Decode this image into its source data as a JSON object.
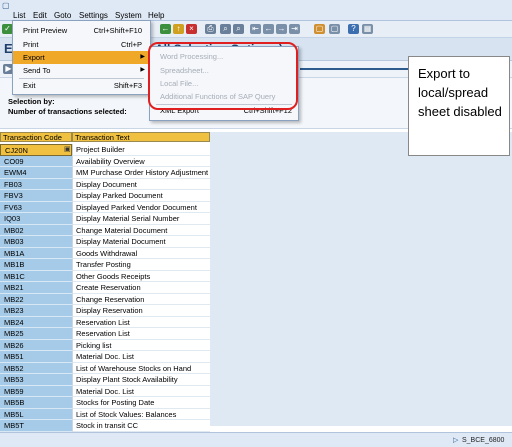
{
  "menubar": {
    "items": [
      "List",
      "Edit",
      "Goto",
      "Settings",
      "System",
      "Help"
    ]
  },
  "window": {
    "title": "All Selection Options )",
    "title_prefix": "E"
  },
  "info": {
    "selected_by": "Selection by:",
    "num_transactions": "Number of transactions selected:"
  },
  "list_menu": {
    "items": [
      {
        "label": "Print Preview",
        "shortcut": "Ctrl+Shift+F10"
      },
      {
        "label": "Print",
        "shortcut": "Ctrl+P"
      },
      {
        "label": "Export",
        "shortcut": ""
      },
      {
        "label": "Send To",
        "shortcut": ""
      },
      {
        "label": "Exit",
        "shortcut": "Shift+F3"
      }
    ]
  },
  "export_menu": {
    "items": [
      {
        "label": "Word Processing...",
        "shortcut": ""
      },
      {
        "label": "Spreadsheet...",
        "shortcut": ""
      },
      {
        "label": "Local File...",
        "shortcut": ""
      },
      {
        "label": "Additional Functions of SAP Query",
        "shortcut": ""
      },
      {
        "label": "XML Export",
        "shortcut": "Ctrl+Shift+F12"
      }
    ]
  },
  "annotation": {
    "text": "Export to local/spread sheet disabled"
  },
  "grid": {
    "headers": [
      "Transaction Code",
      "Transaction Text"
    ],
    "rows": [
      [
        "CJ20N",
        "Project Builder"
      ],
      [
        "CO09",
        "Availability Overview"
      ],
      [
        "EWM4",
        "MM Purchase Order History Adjustment"
      ],
      [
        "FB03",
        "Display Document"
      ],
      [
        "FBV3",
        "Display Parked Document"
      ],
      [
        "FV63",
        "Displayed Parked Vendor Document"
      ],
      [
        "IQ03",
        "Display Material Serial Number"
      ],
      [
        "MB02",
        "Change Material Document"
      ],
      [
        "MB03",
        "Display Material Document"
      ],
      [
        "MB1A",
        "Goods Withdrawal"
      ],
      [
        "MB1B",
        "Transfer Posting"
      ],
      [
        "MB1C",
        "Other Goods Receipts"
      ],
      [
        "MB21",
        "Create Reservation"
      ],
      [
        "MB22",
        "Change Reservation"
      ],
      [
        "MB23",
        "Display Reservation"
      ],
      [
        "MB24",
        "Reservation List"
      ],
      [
        "MB25",
        "Reservation List"
      ],
      [
        "MB26",
        "Picking list"
      ],
      [
        "MB51",
        "Material Doc. List"
      ],
      [
        "MB52",
        "List of Warehouse Stocks on Hand"
      ],
      [
        "MB53",
        "Display Plant Stock Availability"
      ],
      [
        "MB59",
        "Material Doc. List"
      ],
      [
        "MB5B",
        "Stocks for Posting Date"
      ],
      [
        "MB5L",
        "List of Stock Values: Balances"
      ],
      [
        "MB5T",
        "Stock in transit CC"
      ]
    ]
  },
  "status": {
    "system": "S_BCE_6800"
  },
  "colors": {
    "highlight": "#f0a828",
    "grid_header": "#f0c040",
    "code_column": "#a6cbe8",
    "callout_border": "#e02020"
  }
}
